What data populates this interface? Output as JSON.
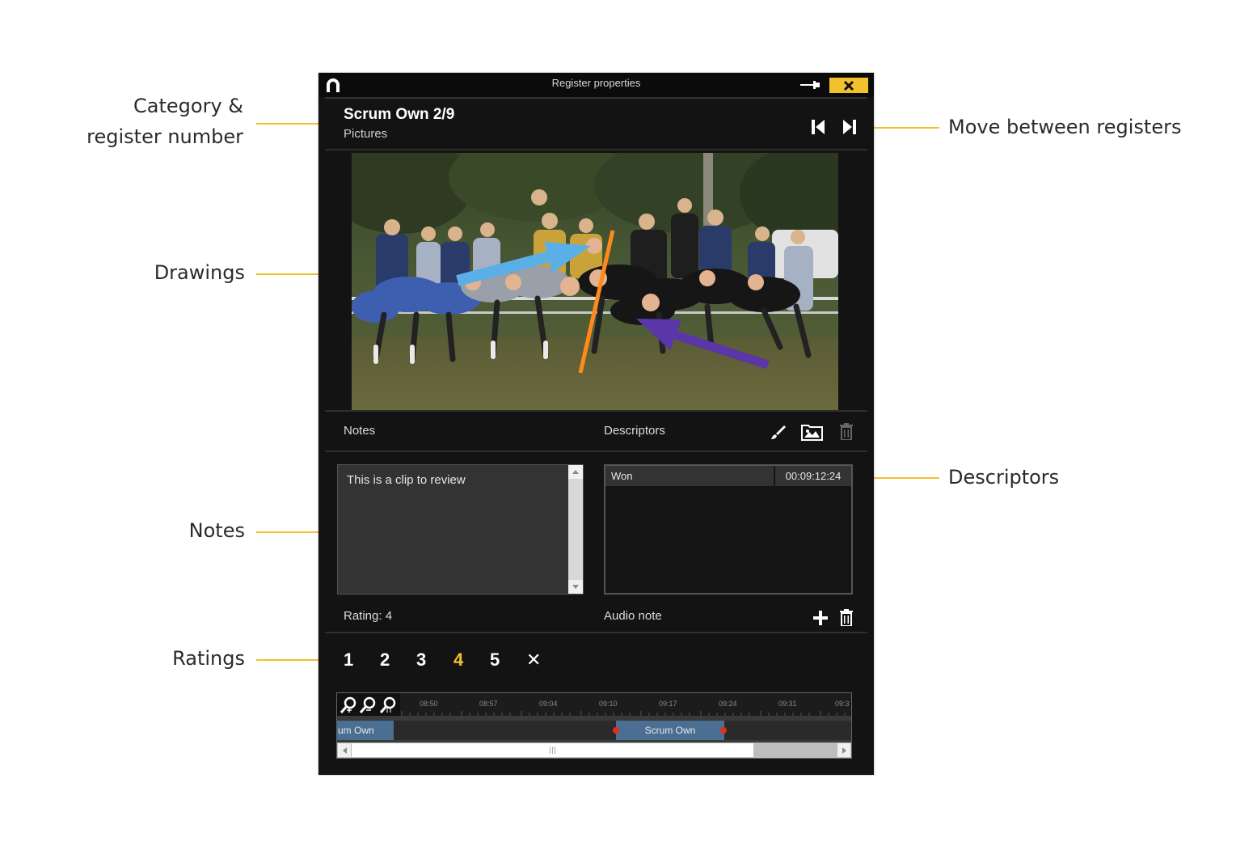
{
  "callouts": {
    "category_line1": "Category &",
    "category_line2": "register number",
    "drawings": "Drawings",
    "notes": "Notes",
    "ratings": "Ratings",
    "move": "Move between registers",
    "descriptors": "Descriptors"
  },
  "window": {
    "title": "Register properties",
    "header_title": "Scrum Own 2/9",
    "header_subtitle": "Pictures"
  },
  "sections": {
    "notes_label": "Notes",
    "descriptors_label": "Descriptors",
    "rating_label": "Rating: 4",
    "audio_label": "Audio note"
  },
  "notes": {
    "text": "This is a clip to review"
  },
  "descriptors": [
    {
      "name": "Won",
      "time": "00:09:12:24"
    }
  ],
  "ratings": {
    "options": [
      "1",
      "2",
      "3",
      "4",
      "5",
      "✕"
    ],
    "selected": "4",
    "selected_color": "#f2c12e"
  },
  "timeline": {
    "ticks": [
      "08:50",
      "08:57",
      "09:04",
      "09:10",
      "09:17",
      "09:24",
      "09:31",
      "09:3"
    ],
    "clips": [
      "um Own",
      "Scrum Own"
    ]
  },
  "colors": {
    "accent": "#f2c12e",
    "window_bg": "#131313",
    "clip": "#4b6f93"
  },
  "icons": [
    "app-logo-icon",
    "pin-icon",
    "close-icon",
    "first-register-icon",
    "next-register-icon",
    "brush-icon",
    "image-folder-icon",
    "trash-icon",
    "add-icon",
    "zoom-in-icon",
    "zoom-out-icon",
    "zoom-reset-icon"
  ]
}
